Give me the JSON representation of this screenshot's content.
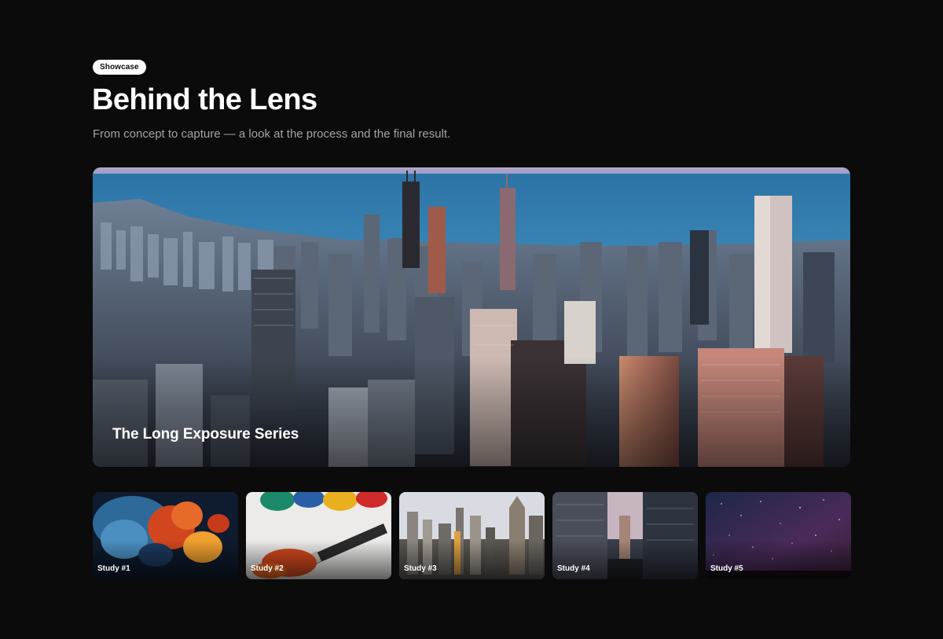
{
  "header": {
    "badge": "Showcase",
    "title": "Behind the Lens",
    "subtitle": "From concept to capture — a look at the process and the final result."
  },
  "featured": {
    "caption": "The Long Exposure Series",
    "image": "aerial-city-skyline-at-dusk"
  },
  "thumbnails": [
    {
      "label": "Study #1",
      "image": "abstract-ink-splash"
    },
    {
      "label": "Study #2",
      "image": "paint-palette-brush"
    },
    {
      "label": "Study #3",
      "image": "city-skyline-day"
    },
    {
      "label": "Study #4",
      "image": "city-street-canyon"
    },
    {
      "label": "Study #5",
      "image": "starry-night-sky"
    }
  ],
  "colors": {
    "background": "#0b0b0c",
    "badge_bg": "#ffffff",
    "subtitle": "#a4a4a8"
  }
}
